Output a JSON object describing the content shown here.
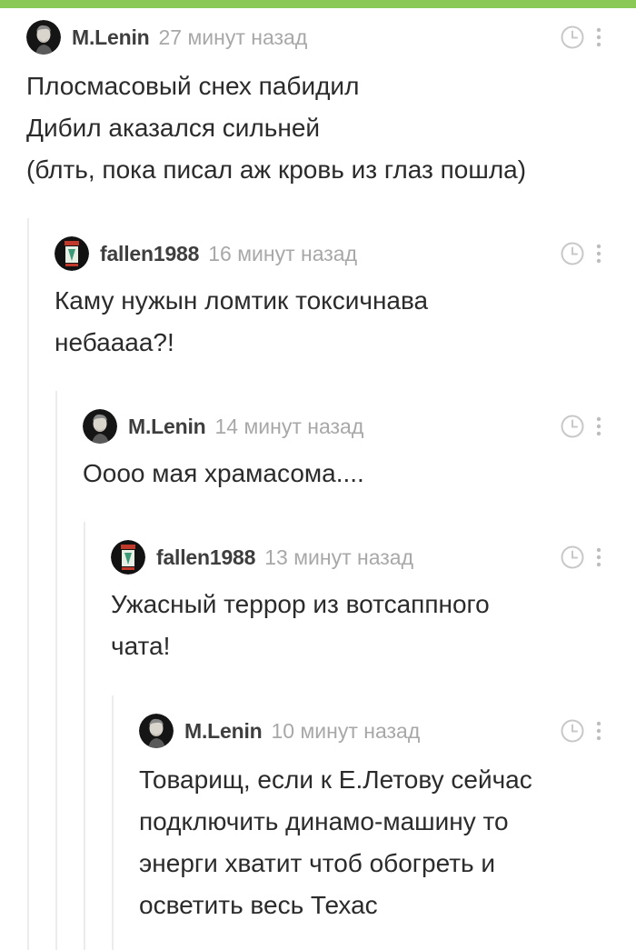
{
  "accent_color": "#8ac858",
  "comments": [
    {
      "username": "M.Lenin",
      "time": "27 минут назад",
      "avatar": "lenin-avatar",
      "lines": [
        "Плосмасовый снех пабидил",
        "Дибил аказался сильней",
        "(блть, пока писал аж кровь из глаз пошла)"
      ]
    },
    {
      "username": "fallen1988",
      "time": "16 минут назад",
      "avatar": "fallen-avatar",
      "lines": [
        "Каму нужын ломтик токсичнава",
        "небаааа?!"
      ]
    },
    {
      "username": "M.Lenin",
      "time": "14 минут назад",
      "avatar": "lenin-avatar",
      "lines": [
        "Оооо мая храмасома...."
      ]
    },
    {
      "username": "fallen1988",
      "time": "13 минут назад",
      "avatar": "fallen-avatar",
      "lines": [
        "Ужасный террор из вотсаппного",
        "чата!"
      ]
    },
    {
      "username": "M.Lenin",
      "time": "10 минут назад",
      "avatar": "lenin-avatar",
      "lines": [
        "Товарищ, если к Е.Летову сейчас",
        "подключить динамо-машину то",
        "энерги хватит чтоб обогреть и",
        "осветить весь Техас"
      ]
    }
  ]
}
